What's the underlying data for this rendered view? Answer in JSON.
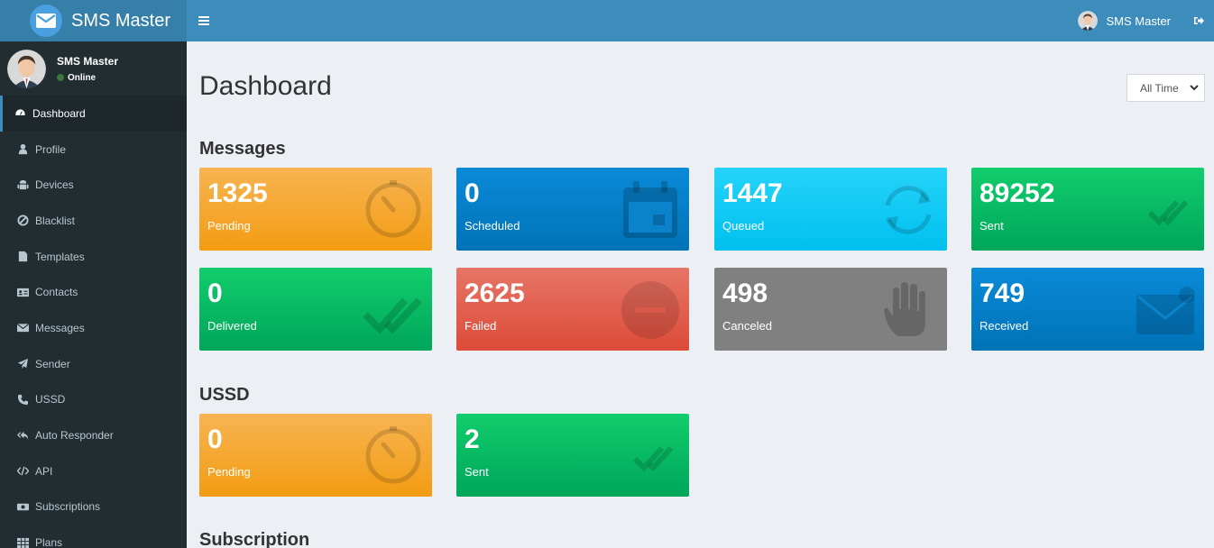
{
  "app": {
    "title": "SMS Master"
  },
  "header": {
    "user_name": "SMS Master"
  },
  "sidebar": {
    "user": {
      "name": "SMS Master",
      "status": "Online"
    },
    "items": [
      {
        "label": "Dashboard",
        "icon": "dashboard-icon"
      },
      {
        "label": "Profile",
        "icon": "user-icon"
      },
      {
        "label": "Devices",
        "icon": "android-icon"
      },
      {
        "label": "Blacklist",
        "icon": "ban-icon"
      },
      {
        "label": "Templates",
        "icon": "template-icon"
      },
      {
        "label": "Contacts",
        "icon": "address-card-icon"
      },
      {
        "label": "Messages",
        "icon": "envelope-icon"
      },
      {
        "label": "Sender",
        "icon": "paper-plane-icon"
      },
      {
        "label": "USSD",
        "icon": "phone-icon"
      },
      {
        "label": "Auto Responder",
        "icon": "reply-all-icon"
      },
      {
        "label": "API",
        "icon": "code-icon"
      },
      {
        "label": "Subscriptions",
        "icon": "money-icon"
      },
      {
        "label": "Plans",
        "icon": "table-icon"
      }
    ]
  },
  "main": {
    "title": "Dashboard",
    "range_filter": "All Time",
    "messages_section": "Messages",
    "ussd_section": "USSD",
    "subscription_section": "Subscription",
    "message_tiles": [
      {
        "value": "1325",
        "label": "Pending",
        "color": "#f39c12",
        "icon": "timer-icon"
      },
      {
        "value": "0",
        "label": "Scheduled",
        "color": "#0073b7",
        "icon": "calendar-icon"
      },
      {
        "value": "1447",
        "label": "Queued",
        "color": "#00c0ef",
        "icon": "refresh-icon"
      },
      {
        "value": "89252",
        "label": "Sent",
        "color": "#00a65a",
        "icon": "double-check-icon"
      },
      {
        "value": "0",
        "label": "Delivered",
        "color": "#00a65a",
        "icon": "double-check-icon"
      },
      {
        "value": "2625",
        "label": "Failed",
        "color": "#dd4b39",
        "icon": "minus-circle-icon"
      },
      {
        "value": "498",
        "label": "Canceled",
        "color": "#808080",
        "icon": "hand-stop-icon"
      },
      {
        "value": "749",
        "label": "Received",
        "color": "#0073b7",
        "icon": "envelope-received-icon"
      }
    ],
    "ussd_tiles": [
      {
        "value": "0",
        "label": "Pending",
        "color": "#f39c12",
        "icon": "timer-icon"
      },
      {
        "value": "2",
        "label": "Sent",
        "color": "#00a65a",
        "icon": "double-check-icon"
      }
    ]
  }
}
